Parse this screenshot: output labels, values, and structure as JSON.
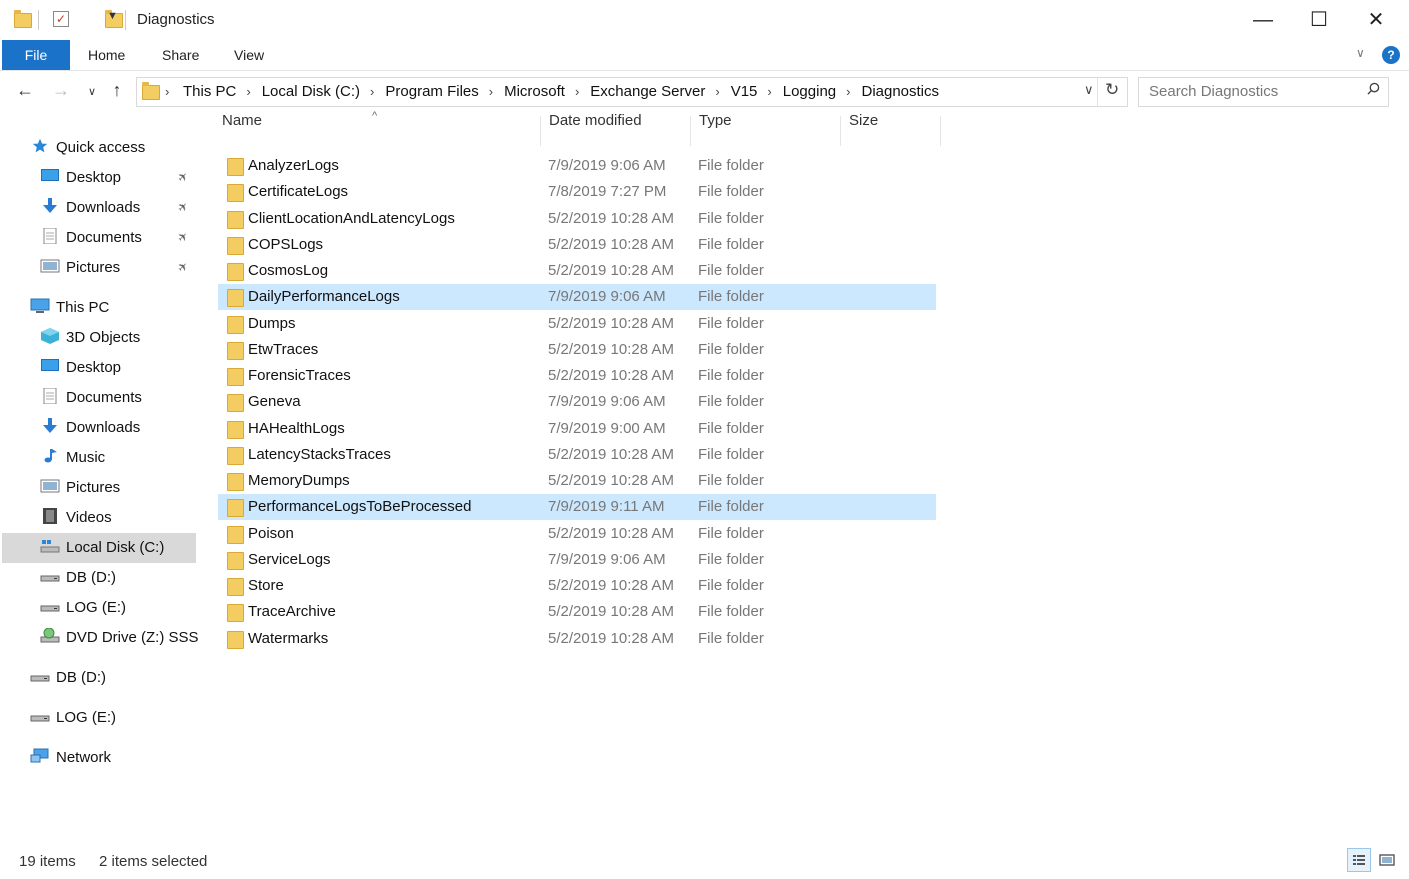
{
  "window": {
    "title": "Diagnostics",
    "controls": [
      "minimize",
      "maximize",
      "close"
    ]
  },
  "ribbon": {
    "tabs": [
      "File",
      "Home",
      "Share",
      "View"
    ],
    "help": "?"
  },
  "breadcrumb": [
    "This PC",
    "Local Disk (C:)",
    "Program Files",
    "Microsoft",
    "Exchange Server",
    "V15",
    "Logging",
    "Diagnostics"
  ],
  "search": {
    "placeholder": "Search Diagnostics"
  },
  "nav": {
    "quick_access": "Quick access",
    "quick_items": [
      "Desktop",
      "Downloads",
      "Documents",
      "Pictures"
    ],
    "this_pc": "This PC",
    "pc_items": [
      "3D Objects",
      "Desktop",
      "Documents",
      "Downloads",
      "Music",
      "Pictures",
      "Videos",
      "Local Disk (C:)",
      "DB (D:)",
      "LOG (E:)",
      "DVD Drive (Z:) SSS_)"
    ],
    "drives": [
      "DB (D:)",
      "LOG (E:)"
    ],
    "network": "Network"
  },
  "columns": [
    "Name",
    "Date modified",
    "Type",
    "Size"
  ],
  "files": [
    {
      "name": "AnalyzerLogs",
      "date": "7/9/2019 9:06 AM",
      "type": "File folder",
      "selected": false
    },
    {
      "name": "CertificateLogs",
      "date": "7/8/2019 7:27 PM",
      "type": "File folder",
      "selected": false
    },
    {
      "name": "ClientLocationAndLatencyLogs",
      "date": "5/2/2019 10:28 AM",
      "type": "File folder",
      "selected": false
    },
    {
      "name": "COPSLogs",
      "date": "5/2/2019 10:28 AM",
      "type": "File folder",
      "selected": false
    },
    {
      "name": "CosmosLog",
      "date": "5/2/2019 10:28 AM",
      "type": "File folder",
      "selected": false
    },
    {
      "name": "DailyPerformanceLogs",
      "date": "7/9/2019 9:06 AM",
      "type": "File folder",
      "selected": true
    },
    {
      "name": "Dumps",
      "date": "5/2/2019 10:28 AM",
      "type": "File folder",
      "selected": false
    },
    {
      "name": "EtwTraces",
      "date": "5/2/2019 10:28 AM",
      "type": "File folder",
      "selected": false
    },
    {
      "name": "ForensicTraces",
      "date": "5/2/2019 10:28 AM",
      "type": "File folder",
      "selected": false
    },
    {
      "name": "Geneva",
      "date": "7/9/2019 9:06 AM",
      "type": "File folder",
      "selected": false
    },
    {
      "name": "HAHealthLogs",
      "date": "7/9/2019 9:00 AM",
      "type": "File folder",
      "selected": false
    },
    {
      "name": "LatencyStacksTraces",
      "date": "5/2/2019 10:28 AM",
      "type": "File folder",
      "selected": false
    },
    {
      "name": "MemoryDumps",
      "date": "5/2/2019 10:28 AM",
      "type": "File folder",
      "selected": false
    },
    {
      "name": "PerformanceLogsToBeProcessed",
      "date": "7/9/2019 9:11 AM",
      "type": "File folder",
      "selected": true
    },
    {
      "name": "Poison",
      "date": "5/2/2019 10:28 AM",
      "type": "File folder",
      "selected": false
    },
    {
      "name": "ServiceLogs",
      "date": "7/9/2019 9:06 AM",
      "type": "File folder",
      "selected": false
    },
    {
      "name": "Store",
      "date": "5/2/2019 10:28 AM",
      "type": "File folder",
      "selected": false
    },
    {
      "name": "TraceArchive",
      "date": "5/2/2019 10:28 AM",
      "type": "File folder",
      "selected": false
    },
    {
      "name": "Watermarks",
      "date": "5/2/2019 10:28 AM",
      "type": "File folder",
      "selected": false
    }
  ],
  "status": {
    "items": "19 items",
    "selected": "2 items selected"
  },
  "colors": {
    "accent": "#1a73c9",
    "selection": "#cce8ff",
    "folder": "#f4cd62"
  }
}
